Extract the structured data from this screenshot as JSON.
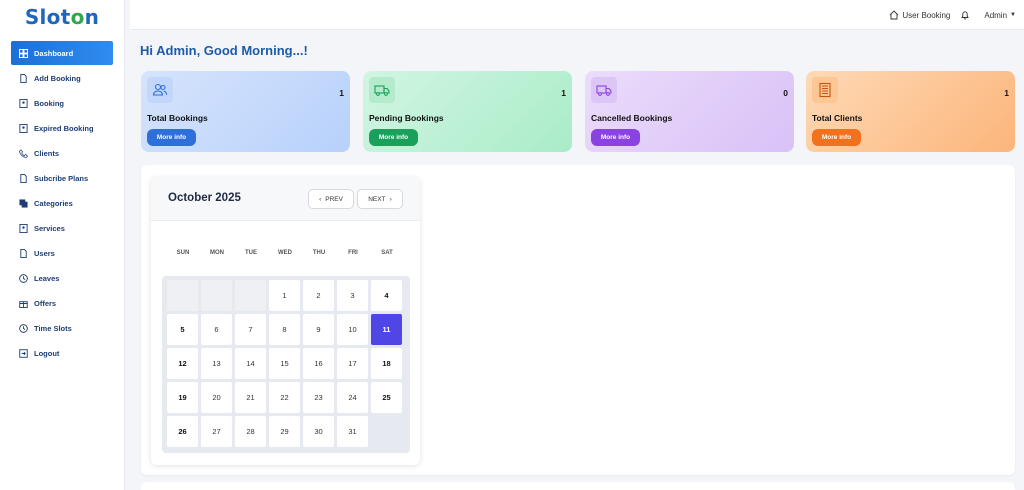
{
  "app": {
    "logo_prefix": "Slot",
    "logo_o": "o",
    "logo_suffix": "n"
  },
  "sidebar": {
    "items": [
      {
        "label": "Dashboard",
        "icon": "dashboard-icon"
      },
      {
        "label": "Add Booking",
        "icon": "document-icon"
      },
      {
        "label": "Booking",
        "icon": "contact-icon"
      },
      {
        "label": "Expired Booking",
        "icon": "contact-icon"
      },
      {
        "label": "Clients",
        "icon": "phone-icon"
      },
      {
        "label": "Subcribe Plans",
        "icon": "document-icon"
      },
      {
        "label": "Categories",
        "icon": "copy-icon"
      },
      {
        "label": "Services",
        "icon": "contact-icon"
      },
      {
        "label": "Users",
        "icon": "document-icon"
      },
      {
        "label": "Leaves",
        "icon": "clock-icon"
      },
      {
        "label": "Offers",
        "icon": "gift-icon"
      },
      {
        "label": "Time Slots",
        "icon": "clock-icon"
      },
      {
        "label": "Logout",
        "icon": "logout-icon"
      }
    ]
  },
  "topbar": {
    "user_booking": "User Booking",
    "admin": "Admin"
  },
  "greeting": "Hi Admin, Good Morning...!",
  "cards": [
    {
      "title": "Total Bookings",
      "count": "1",
      "button": "More info",
      "icon": "users-icon"
    },
    {
      "title": "Pending Bookings",
      "count": "1",
      "button": "More info",
      "icon": "truck-icon"
    },
    {
      "title": "Cancelled Bookings",
      "count": "0",
      "button": "More info",
      "icon": "truck-icon"
    },
    {
      "title": "Total Clients",
      "count": "1",
      "button": "More info",
      "icon": "building-icon"
    }
  ],
  "calendar": {
    "month": "October 2025",
    "prev": "PREV",
    "next": "NEXT",
    "weekdays": [
      "SUN",
      "MON",
      "TUE",
      "WED",
      "THU",
      "FRI",
      "SAT"
    ],
    "weeks": [
      [
        "",
        "",
        "",
        "1",
        "2",
        "3",
        "4"
      ],
      [
        "5",
        "6",
        "7",
        "8",
        "9",
        "10",
        "11"
      ],
      [
        "12",
        "13",
        "14",
        "15",
        "16",
        "17",
        "18"
      ],
      [
        "19",
        "20",
        "21",
        "22",
        "23",
        "24",
        "25"
      ],
      [
        "26",
        "27",
        "28",
        "29",
        "30",
        "31",
        ""
      ]
    ],
    "today": "11"
  },
  "colors": {
    "accent": "#1d6fd6",
    "today": "#4f46e5"
  }
}
